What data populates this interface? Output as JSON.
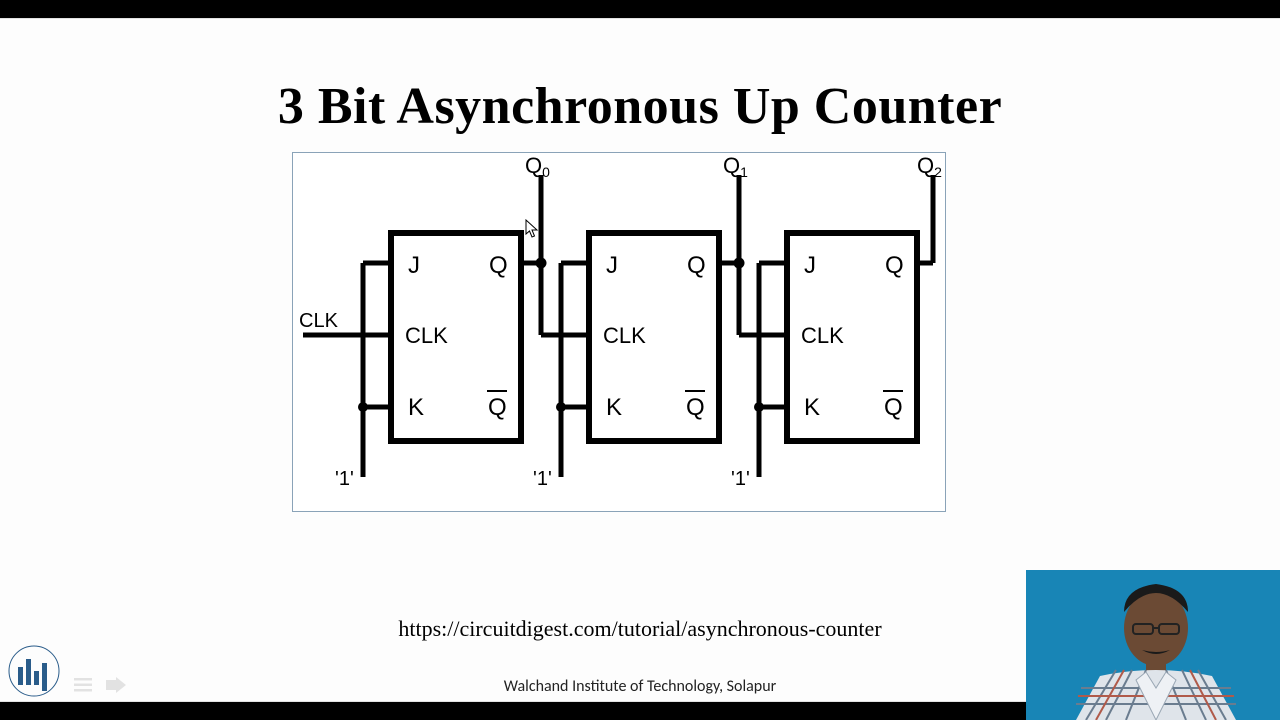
{
  "slide": {
    "title": "3 Bit Asynchronous Up Counter",
    "url": "https://circuitdigest.com/tutorial/asynchronous-counter",
    "footer": "Walchand Institute of Technology, Solapur"
  },
  "diagram": {
    "clk_label": "CLK",
    "one_label": "'1'",
    "flipflops": [
      {
        "output": "Q",
        "output_sub": "0",
        "j": "J",
        "k": "K",
        "clk": "CLK",
        "q": "Q",
        "qbar_base": "Q"
      },
      {
        "output": "Q",
        "output_sub": "1",
        "j": "J",
        "k": "K",
        "clk": "CLK",
        "q": "Q",
        "qbar_base": "Q"
      },
      {
        "output": "Q",
        "output_sub": "2",
        "j": "J",
        "k": "K",
        "clk": "CLK",
        "q": "Q",
        "qbar_base": "Q"
      }
    ]
  }
}
